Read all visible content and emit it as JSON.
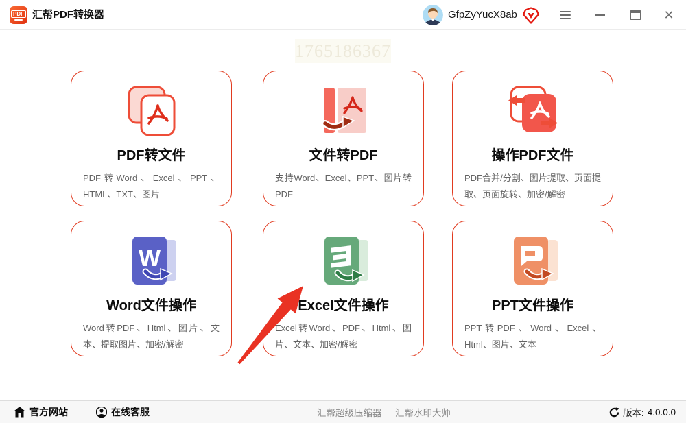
{
  "window": {
    "logo_text": "PDF",
    "title": "汇帮PDF转换器",
    "username": "GfpZyYucX8ab"
  },
  "watermark_number": "1765186367",
  "cards": [
    {
      "id": "pdf-to-file",
      "title": "PDF转文件",
      "desc": "PDF转Word、Excel、PPT、HTML、TXT、图片"
    },
    {
      "id": "file-to-pdf",
      "title": "文件转PDF",
      "desc": "支持Word、Excel、PPT、图片转PDF"
    },
    {
      "id": "operate-pdf",
      "title": "操作PDF文件",
      "desc": "PDF合并/分割、图片提取、页面提取、页面旋转、加密/解密"
    },
    {
      "id": "word-ops",
      "title": "Word文件操作",
      "desc": "Word转PDF、Html、图片、文本、提取图片、加密/解密"
    },
    {
      "id": "excel-ops",
      "title": "Excel文件操作",
      "desc": "Excel转Word、PDF、Html、图片、文本、加密/解密"
    },
    {
      "id": "ppt-ops",
      "title": "PPT文件操作",
      "desc": "PPT转PDF、Word、Excel、Html、图片、文本"
    }
  ],
  "footer": {
    "official_site": "官方网站",
    "online_service": "在线客服",
    "super_compressor": "汇帮超级压缩器",
    "watermark_master": "汇帮水印大师",
    "version_label": "版本:",
    "version_value": "4.0.0.0"
  },
  "colors": {
    "accent_red": "#e13b20",
    "card_border": "#e13b20",
    "word_blue": "#5a61c6",
    "excel_green": "#66a97a",
    "ppt_orange": "#ef9066",
    "annotation_arrow": "#e93223"
  }
}
